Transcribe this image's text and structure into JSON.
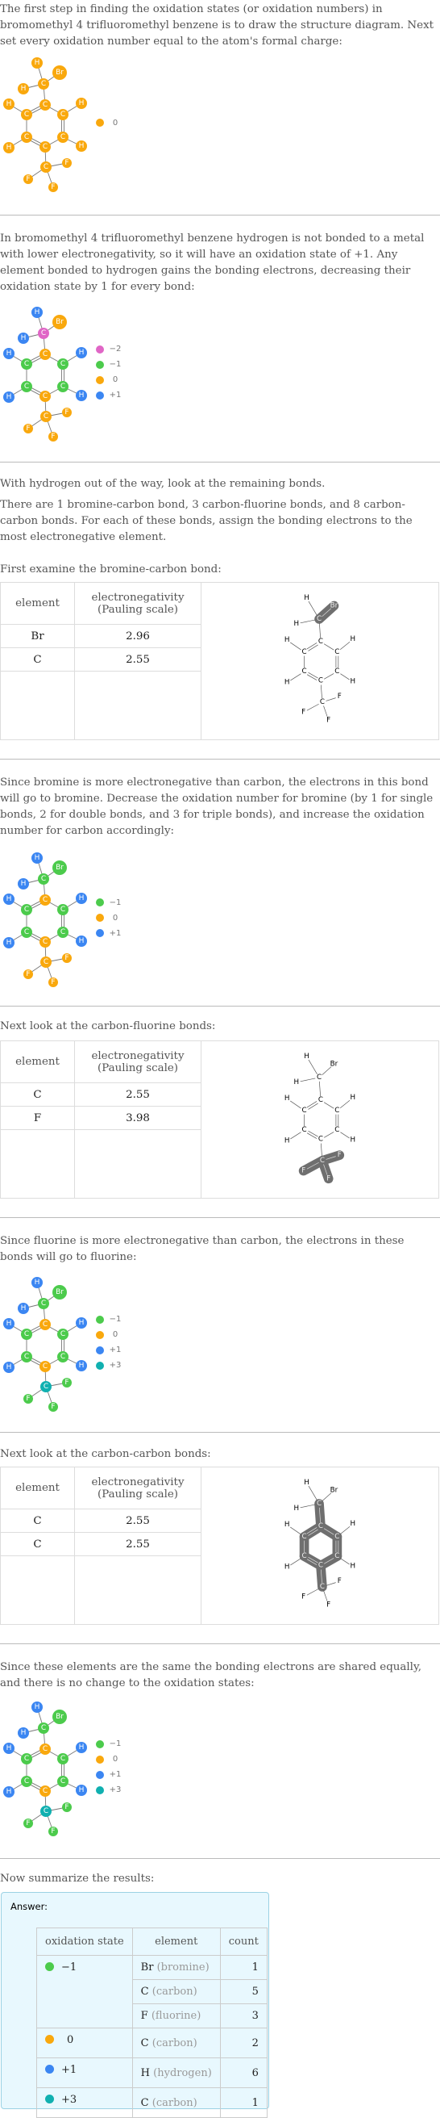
{
  "colors": {
    "neg2": "#e066c6",
    "neg1": "#4ccb4c",
    "zero": "#f9a80d",
    "pos1": "#3b86f2",
    "pos3": "#10b0b0",
    "highlight": "#6f6f6f"
  },
  "sections": {
    "intro": "The first step in finding the oxidation states (or oxidation numbers) in bromomethyl 4 trifluoromethyl benzene is to draw the structure diagram. Next set every oxidation number equal to the atom's formal charge:",
    "hydrogen": "In bromomethyl 4 trifluoromethyl benzene hydrogen is not bonded to a metal with lower electronegativity, so it will have an oxidation state of +1. Any element bonded to hydrogen gains the bonding electrons, decreasing their oxidation state by 1 for every bond:",
    "remaining_1": "With hydrogen out of the way, look at the remaining bonds.",
    "remaining_2": "There are 1 bromine-carbon bond, 3 carbon-fluorine bonds, and 8 carbon-carbon bonds.  For each of these bonds, assign the bonding electrons to the most electronegative element.",
    "br_c_intro": "First examine the bromine-carbon bond:",
    "br_c_result": "Since bromine is more electronegative than carbon, the electrons in this bond will go to bromine. Decrease the oxidation number for bromine (by 1 for single bonds, 2 for double bonds, and 3 for triple bonds), and increase the oxidation number for carbon accordingly:",
    "c_f_intro": "Next look at the carbon-fluorine bonds:",
    "c_f_result": "Since fluorine is more electronegative than carbon, the electrons in these bonds will go to fluorine:",
    "c_c_intro": "Next look at the carbon-carbon bonds:",
    "c_c_result": "Since these elements are the same the bonding electrons are shared equally, and there is no change to the oxidation states:",
    "summary_intro": "Now summarize the results:"
  },
  "molecule": {
    "atoms": [
      {
        "id": "H1",
        "el": "H"
      },
      {
        "id": "Br",
        "el": "Br"
      },
      {
        "id": "Cm",
        "el": "C"
      },
      {
        "id": "H2",
        "el": "H"
      },
      {
        "id": "C1",
        "el": "C"
      },
      {
        "id": "C2",
        "el": "C"
      },
      {
        "id": "C6",
        "el": "C"
      },
      {
        "id": "H3",
        "el": "H"
      },
      {
        "id": "H4",
        "el": "H"
      },
      {
        "id": "C3",
        "el": "C"
      },
      {
        "id": "C5",
        "el": "C"
      },
      {
        "id": "H5",
        "el": "H"
      },
      {
        "id": "H6",
        "el": "H"
      },
      {
        "id": "C4",
        "el": "C"
      },
      {
        "id": "Cf",
        "el": "C"
      },
      {
        "id": "F1",
        "el": "F"
      },
      {
        "id": "F2",
        "el": "F"
      },
      {
        "id": "F3",
        "el": "F"
      }
    ],
    "bonds": [
      [
        "H1",
        "Cm",
        1
      ],
      [
        "Br",
        "Cm",
        1
      ],
      [
        "H2",
        "Cm",
        1
      ],
      [
        "Cm",
        "C1",
        1
      ],
      [
        "C1",
        "C2",
        2
      ],
      [
        "C1",
        "C6",
        1
      ],
      [
        "C2",
        "C3",
        1
      ],
      [
        "C6",
        "C5",
        2
      ],
      [
        "C3",
        "C4",
        2
      ],
      [
        "C5",
        "C4",
        1
      ],
      [
        "C2",
        "H3",
        1
      ],
      [
        "C6",
        "H4",
        1
      ],
      [
        "C3",
        "H5",
        1
      ],
      [
        "C5",
        "H6",
        1
      ],
      [
        "C4",
        "Cf",
        1
      ],
      [
        "Cf",
        "F1",
        1
      ],
      [
        "Cf",
        "F2",
        1
      ],
      [
        "Cf",
        "F3",
        1
      ]
    ]
  },
  "diagrams": [
    {
      "states": {
        "H1": "zero",
        "Br": "zero",
        "Cm": "zero",
        "H2": "zero",
        "C1": "zero",
        "C2": "zero",
        "C6": "zero",
        "H3": "zero",
        "H4": "zero",
        "C3": "zero",
        "C5": "zero",
        "H5": "zero",
        "H6": "zero",
        "C4": "zero",
        "Cf": "zero",
        "F1": "zero",
        "F2": "zero",
        "F3": "zero"
      },
      "legend": [
        {
          "key": "zero",
          "label": "0"
        }
      ]
    },
    {
      "states": {
        "H1": "pos1",
        "Br": "zero",
        "Cm": "neg2",
        "H2": "pos1",
        "C1": "zero",
        "C2": "neg1",
        "C6": "neg1",
        "H3": "pos1",
        "H4": "pos1",
        "C3": "neg1",
        "C5": "neg1",
        "H5": "pos1",
        "H6": "pos1",
        "C4": "zero",
        "Cf": "zero",
        "F1": "zero",
        "F2": "zero",
        "F3": "zero"
      },
      "legend": [
        {
          "key": "neg2",
          "label": "−2"
        },
        {
          "key": "neg1",
          "label": "−1"
        },
        {
          "key": "zero",
          "label": "0"
        },
        {
          "key": "pos1",
          "label": "+1"
        }
      ]
    },
    {
      "states": {
        "H1": "pos1",
        "Br": "neg1",
        "Cm": "neg1",
        "H2": "pos1",
        "C1": "zero",
        "C2": "neg1",
        "C6": "neg1",
        "H3": "pos1",
        "H4": "pos1",
        "C3": "neg1",
        "C5": "neg1",
        "H5": "pos1",
        "H6": "pos1",
        "C4": "zero",
        "Cf": "zero",
        "F1": "zero",
        "F2": "zero",
        "F3": "zero"
      },
      "legend": [
        {
          "key": "neg1",
          "label": "−1"
        },
        {
          "key": "zero",
          "label": "0"
        },
        {
          "key": "pos1",
          "label": "+1"
        }
      ]
    },
    {
      "states": {
        "H1": "pos1",
        "Br": "neg1",
        "Cm": "neg1",
        "H2": "pos1",
        "C1": "zero",
        "C2": "neg1",
        "C6": "neg1",
        "H3": "pos1",
        "H4": "pos1",
        "C3": "neg1",
        "C5": "neg1",
        "H5": "pos1",
        "H6": "pos1",
        "C4": "zero",
        "Cf": "pos3",
        "F1": "neg1",
        "F2": "neg1",
        "F3": "neg1"
      },
      "legend": [
        {
          "key": "neg1",
          "label": "−1"
        },
        {
          "key": "zero",
          "label": "0"
        },
        {
          "key": "pos1",
          "label": "+1"
        },
        {
          "key": "pos3",
          "label": "+3"
        }
      ]
    },
    {
      "states": {
        "H1": "pos1",
        "Br": "neg1",
        "Cm": "neg1",
        "H2": "pos1",
        "C1": "zero",
        "C2": "neg1",
        "C6": "neg1",
        "H3": "pos1",
        "H4": "pos1",
        "C3": "neg1",
        "C5": "neg1",
        "H5": "pos1",
        "H6": "pos1",
        "C4": "zero",
        "Cf": "pos3",
        "F1": "neg1",
        "F2": "neg1",
        "F3": "neg1"
      },
      "legend": [
        {
          "key": "neg1",
          "label": "−1"
        },
        {
          "key": "zero",
          "label": "0"
        },
        {
          "key": "pos1",
          "label": "+1"
        },
        {
          "key": "pos3",
          "label": "+3"
        }
      ]
    }
  ],
  "tables": [
    {
      "header": [
        "element",
        "electronegativity\n(Pauling scale)"
      ],
      "rows": [
        [
          "Br",
          "2.96"
        ],
        [
          "C",
          "2.55"
        ]
      ],
      "highlight_bonds": [
        [
          "Cm",
          "Br"
        ]
      ]
    },
    {
      "header": [
        "element",
        "electronegativity\n(Pauling scale)"
      ],
      "rows": [
        [
          "C",
          "2.55"
        ],
        [
          "F",
          "3.98"
        ]
      ],
      "highlight_bonds": [
        [
          "Cf",
          "F1"
        ],
        [
          "Cf",
          "F2"
        ],
        [
          "Cf",
          "F3"
        ]
      ]
    },
    {
      "header": [
        "element",
        "electronegativity\n(Pauling scale)"
      ],
      "rows": [
        [
          "C",
          "2.55"
        ],
        [
          "C",
          "2.55"
        ]
      ],
      "highlight_bonds": [
        [
          "Cm",
          "C1"
        ],
        [
          "C1",
          "C2"
        ],
        [
          "C1",
          "C6"
        ],
        [
          "C2",
          "C3"
        ],
        [
          "C6",
          "C5"
        ],
        [
          "C3",
          "C4"
        ],
        [
          "C5",
          "C4"
        ],
        [
          "C4",
          "Cf"
        ]
      ]
    }
  ],
  "answer": {
    "title": "Answer:",
    "headers": [
      "oxidation state",
      "element",
      "count"
    ],
    "groups": [
      {
        "state": "−1",
        "color_key": "neg1",
        "rows": [
          {
            "symbol": "Br",
            "name": "(bromine)",
            "count": "1"
          },
          {
            "symbol": "C",
            "name": "(carbon)",
            "count": "5"
          },
          {
            "symbol": "F",
            "name": "(fluorine)",
            "count": "3"
          }
        ]
      },
      {
        "state": "0",
        "color_key": "zero",
        "rows": [
          {
            "symbol": "C",
            "name": "(carbon)",
            "count": "2"
          }
        ]
      },
      {
        "state": "+1",
        "color_key": "pos1",
        "rows": [
          {
            "symbol": "H",
            "name": "(hydrogen)",
            "count": "6"
          }
        ]
      },
      {
        "state": "+3",
        "color_key": "pos3",
        "rows": [
          {
            "symbol": "C",
            "name": "(carbon)",
            "count": "1"
          }
        ]
      }
    ]
  }
}
